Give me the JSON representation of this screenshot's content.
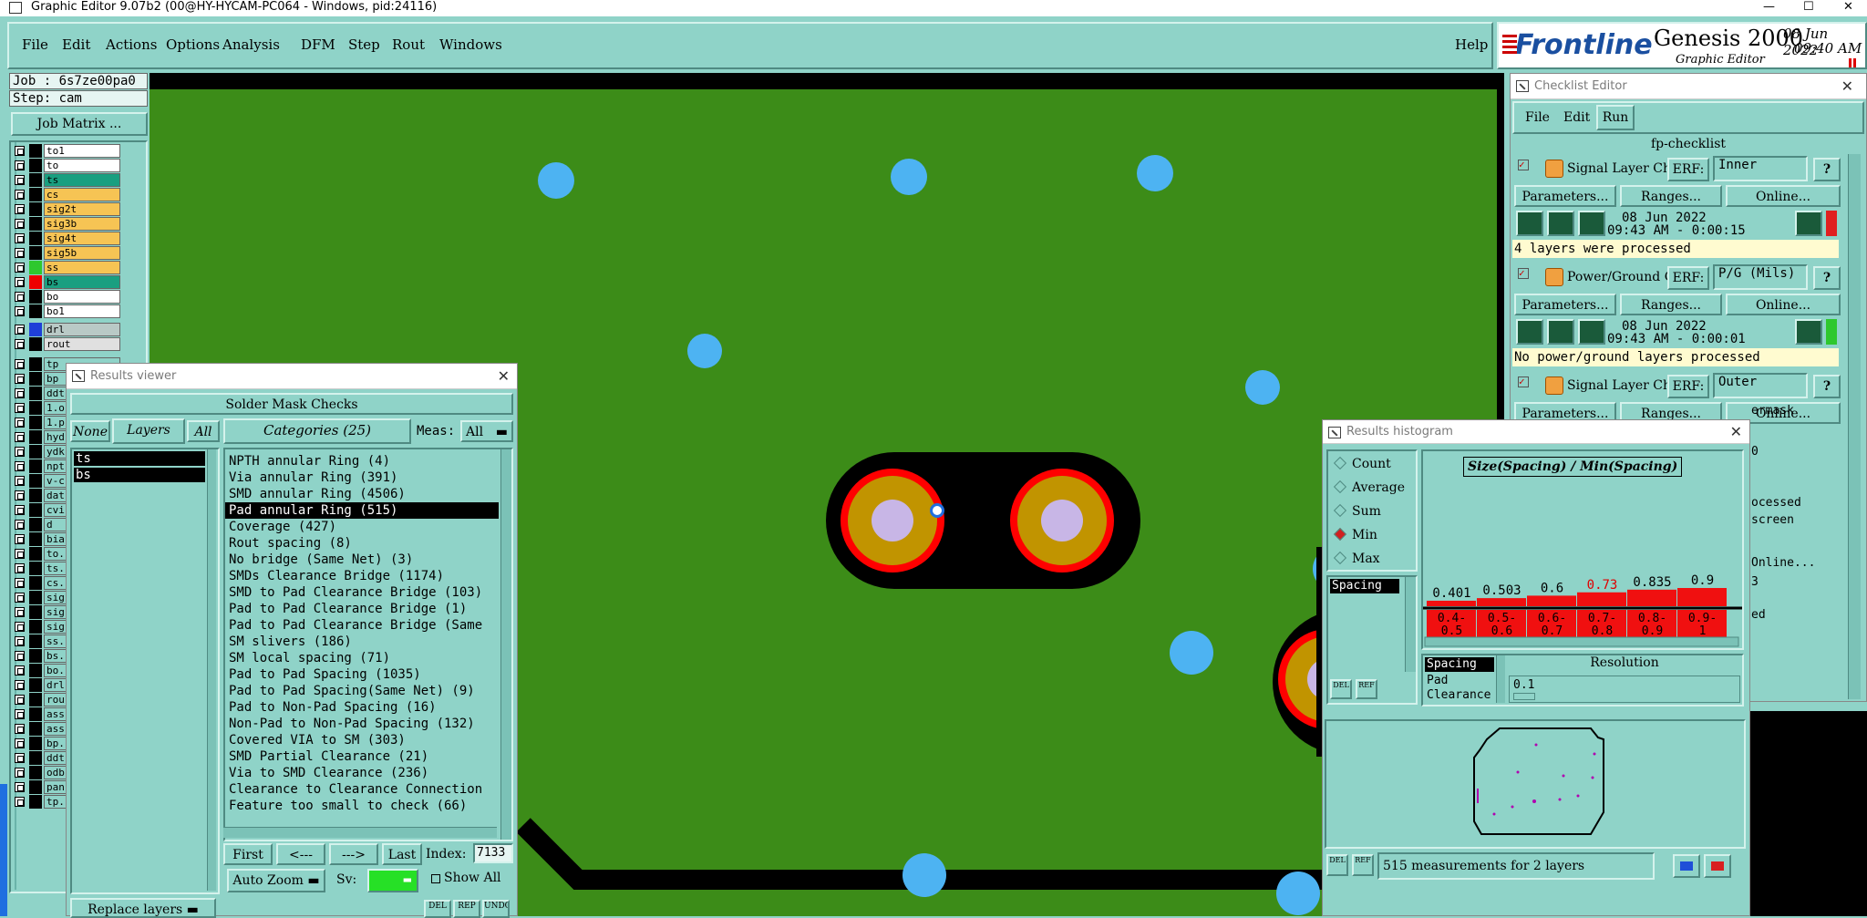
{
  "titlebar": {
    "title": "Graphic Editor 9.07b2 (00@HY-HYCAM-PC064 - Windows, pid:24116)",
    "min": "—",
    "max": "☐",
    "close": "✕"
  },
  "menu": [
    "File",
    "Edit",
    "Actions",
    "Options",
    "Analysis",
    "DFM",
    "Step",
    "Rout",
    "Windows"
  ],
  "help": "Help",
  "brand": {
    "logo": "Frontline",
    "product": "Genesis 2000",
    "sub": "Graphic Editor",
    "date": "08 Jun 2022",
    "time": "09:40 AM"
  },
  "job": {
    "job": "Job : 6s7ze00pa0",
    "step": "Step: cam",
    "matrix": "Job Matrix ..."
  },
  "layers": [
    {
      "name": "to1",
      "color": "#ffffff"
    },
    {
      "name": "to",
      "color": "#ffffff"
    },
    {
      "name": "ts",
      "color": "#1a9f80"
    },
    {
      "name": "cs",
      "color": "#f6c454"
    },
    {
      "name": "sig2t",
      "color": "#f6c454"
    },
    {
      "name": "sig3b",
      "color": "#f6c454"
    },
    {
      "name": "sig4t",
      "color": "#f6c454"
    },
    {
      "name": "sig5b",
      "color": "#f6c454"
    },
    {
      "name": "ss",
      "color": "#f6c454"
    },
    {
      "name": "bs",
      "color": "#1a9f80"
    },
    {
      "name": "bo",
      "color": "#ffffff"
    },
    {
      "name": "bo1",
      "color": "#ffffff"
    }
  ],
  "layers2": [
    {
      "name": "drl",
      "color": "#b9c9c6"
    },
    {
      "name": "rout",
      "color": "#e0e0e0"
    }
  ],
  "layers3": [
    "tp",
    "bp",
    "ddt",
    "1.o",
    "1.p",
    "hyd",
    "ydk",
    "npt",
    "v-c",
    "dat",
    "cvi",
    "d",
    "bia",
    "to.",
    "ts.",
    "cs.",
    "sig",
    "sig",
    "sig",
    "ss.",
    "bs.",
    "bo.",
    "drl",
    "rou",
    "ass",
    "ass",
    "bp.",
    "ddt",
    "odb",
    "pan",
    "tp."
  ],
  "results": {
    "title": "Results viewer",
    "header": "Solder Mask Checks",
    "none": "None",
    "layers": "Layers",
    "all": "All",
    "layer_list": [
      "ts",
      "bs"
    ],
    "categories_label": "Categories (25)",
    "meas_label": "Meas:",
    "meas_value": "All",
    "categories": [
      "NPTH annular Ring (4)",
      "Via annular Ring (391)",
      "SMD annular Ring (4506)",
      "Pad annular Ring (515)",
      "Coverage (427)",
      "Rout spacing (8)",
      "No bridge (Same Net) (3)",
      "SMDs Clearance Bridge (1174)",
      "SMD to Pad Clearance Bridge (103)",
      "Pad to Pad Clearance Bridge (1)",
      "Pad to Pad Clearance Bridge (Same",
      "SM slivers (186)",
      "SM local spacing (71)",
      "Pad to Pad Spacing (1035)",
      "Pad to Pad Spacing(Same Net) (9)",
      "Pad to Non-Pad Spacing (16)",
      "Non-Pad to Non-Pad Spacing (132)",
      "Covered VIA to SM (303)",
      "SMD Partial Clearance (21)",
      "Via to SMD Clearance (236)",
      "Clearance to Clearance Connection",
      "Feature too small to check (66)"
    ],
    "selected_index": 3,
    "first": "First",
    "prev": "<---",
    "next": "--->",
    "last": "Last",
    "index_label": "Index:",
    "index_value": "7133",
    "zoom": "Auto Zoom",
    "sv": "Sv:",
    "show_all": "Show All",
    "replace": "Replace layers"
  },
  "checklist": {
    "title": "Checklist Editor",
    "menu": [
      "File",
      "Edit",
      "Run"
    ],
    "name": "fp-checklist",
    "blocks": [
      {
        "name": "Signal Layer Ch",
        "erf": "ERF:",
        "erf_val": "Inner",
        "params": "Parameters...",
        "ranges": "Ranges...",
        "online": "Online...",
        "date": "08 Jun 2022",
        "time": "09:43 AM - 0:00:15",
        "status": "4 layers were processed",
        "flag": "#e02020"
      },
      {
        "name": "Power/Ground C",
        "erf": "ERF:",
        "erf_val": "P/G (Mils)",
        "params": "Parameters...",
        "ranges": "Ranges...",
        "online": "Online...",
        "date": "08 Jun 2022",
        "time": "09:43 AM - 0:00:01",
        "status": "No power/ground layers processed",
        "flag": "#2ec82e"
      },
      {
        "name": "Signal Layer Ch",
        "erf": "ERF:",
        "erf_val": "Outer",
        "params": "Parameters...",
        "ranges": "Ranges...",
        "online": "Online..."
      }
    ],
    "frag": [
      "ermask",
      "0",
      "ocessed",
      "screen",
      "Online...",
      "3",
      "ed"
    ]
  },
  "histogram": {
    "title": "Results histogram",
    "modes": [
      "Count",
      "Average",
      "Sum",
      "Min",
      "Max"
    ],
    "selected_mode": "Min",
    "list": [
      "Spacing"
    ],
    "chart_title": "Size(Spacing) / Min(Spacing)",
    "bars": [
      {
        "value": "0.401",
        "min": 0.401,
        "range": "0.4-0.5"
      },
      {
        "value": "0.503",
        "min": 0.503,
        "range": "0.5-0.6"
      },
      {
        "value": "0.6",
        "min": 0.6,
        "range": "0.6-0.7"
      },
      {
        "value": "0.73",
        "min": 0.73,
        "range": "0.7-0.8"
      },
      {
        "value": "0.835",
        "min": 0.835,
        "range": "0.8-0.9"
      },
      {
        "value": "0.9",
        "min": 0.9,
        "range": "0.9-1"
      }
    ],
    "highlight_index": 3,
    "attrs": [
      "Spacing",
      "Pad",
      "Clearance"
    ],
    "resolution_label": "Resolution",
    "resolution": "0.1",
    "status": "515 measurements for 2 layers",
    "del": "DEL",
    "ref": "REF"
  },
  "misc": {
    "del": "DEL",
    "rep": "REP",
    "undo": "UNDO"
  }
}
